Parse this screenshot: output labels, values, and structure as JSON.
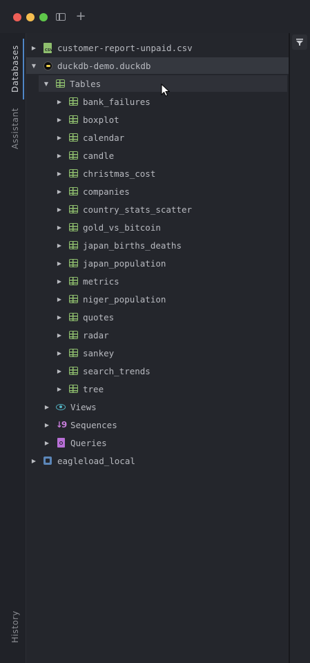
{
  "window": {
    "traffic_lights": [
      "close",
      "minimize",
      "maximize"
    ],
    "toolbar": {
      "sidebar_icon": "sidebar-toggle-icon",
      "new_tab_label": "+"
    }
  },
  "rail": {
    "tabs": [
      {
        "label": "Databases",
        "active": true
      },
      {
        "label": "Assistant",
        "active": false
      }
    ],
    "bottom_tab": {
      "label": "History"
    }
  },
  "tree": {
    "csv_file": {
      "label": "customer-report-unpaid.csv",
      "icon": "csv-file-icon",
      "badge": "CSV"
    },
    "database": {
      "label": "duckdb-demo.duckdb",
      "icon": "duckdb-icon"
    },
    "tables_group": {
      "label": "Tables",
      "icon": "table-icon"
    },
    "tables": [
      {
        "label": "bank_failures"
      },
      {
        "label": "boxplot"
      },
      {
        "label": "calendar"
      },
      {
        "label": "candle"
      },
      {
        "label": "christmas_cost"
      },
      {
        "label": "companies"
      },
      {
        "label": "country_stats_scatter"
      },
      {
        "label": "gold_vs_bitcoin"
      },
      {
        "label": "japan_births_deaths"
      },
      {
        "label": "japan_population"
      },
      {
        "label": "metrics"
      },
      {
        "label": "niger_population"
      },
      {
        "label": "quotes"
      },
      {
        "label": "radar"
      },
      {
        "label": "sankey"
      },
      {
        "label": "search_trends"
      },
      {
        "label": "tree"
      }
    ],
    "views": {
      "label": "Views",
      "icon": "eye-icon"
    },
    "sequences": {
      "label": "Sequences",
      "icon": "sequence-icon"
    },
    "queries": {
      "label": "Queries",
      "icon": "query-file-icon"
    },
    "other_connection": {
      "label": "eagleload_local",
      "icon": "database-icon"
    }
  },
  "right_panel": {
    "filter_icon": "filter-icon"
  },
  "colors": {
    "background": "#24262c",
    "table_icon": "#8fbf6e",
    "views_icon": "#54b6c6",
    "sequence_icon": "#c77ddb",
    "accent": "#4f86c6",
    "text": "#b8bac0"
  }
}
